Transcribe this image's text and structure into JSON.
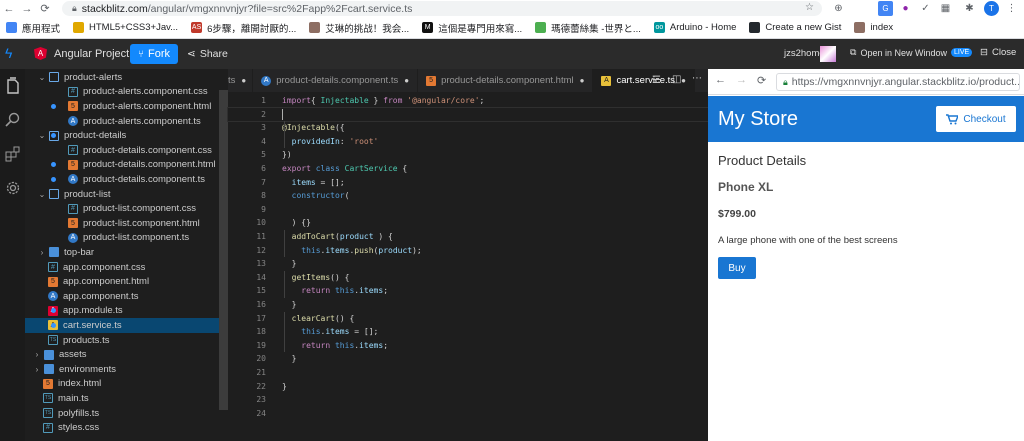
{
  "browser": {
    "url_domain": "stackblitz.com",
    "url_path": "/angular/vmgxnnvnjyr?file=src%2Fapp%2Fcart.service.ts",
    "bookmarks": [
      {
        "label": "應用程式",
        "color": "#4285f4",
        "glyph": ""
      },
      {
        "label": "HTML5+CSS3+Jav...",
        "color": "#e0a800",
        "glyph": ""
      },
      {
        "label": "6步驟，離開討厭的...",
        "color": "#c0392b",
        "glyph": "AS"
      },
      {
        "label": "艾琳的挑战！我会...",
        "color": "#8d6e63",
        "glyph": ""
      },
      {
        "label": "這個是專門用來寫...",
        "color": "#111111",
        "glyph": "M"
      },
      {
        "label": "瑪德蕾絲集 -世界と...",
        "color": "#4caf50",
        "glyph": ""
      },
      {
        "label": "Arduino - Home",
        "color": "#00979d",
        "glyph": "oo"
      },
      {
        "label": "Create a new Gist",
        "color": "#24292e",
        "glyph": ""
      },
      {
        "label": "index",
        "color": "#8d6e63",
        "glyph": ""
      }
    ]
  },
  "header": {
    "project": "Angular Project",
    "fork_label": "Fork",
    "share_label": "Share",
    "user": "jzs2home",
    "open_window": "Open in New Window",
    "live_badge": "LIVE",
    "close_label": "Close"
  },
  "explorer": {
    "items": [
      {
        "label": "product-alerts",
        "type": "folder",
        "level": 0,
        "open": true,
        "dot": false
      },
      {
        "label": "product-alerts.component.css",
        "type": "css",
        "level": 1,
        "dot": false
      },
      {
        "label": "product-alerts.component.html",
        "type": "html",
        "level": 1,
        "dot": true
      },
      {
        "label": "product-alerts.component.ts",
        "type": "ts",
        "level": 1,
        "dot": false
      },
      {
        "label": "product-details",
        "type": "folder",
        "level": 0,
        "open": true,
        "dot": true
      },
      {
        "label": "product-details.component.css",
        "type": "css",
        "level": 1,
        "dot": false
      },
      {
        "label": "product-details.component.html",
        "type": "html",
        "level": 1,
        "dot": true
      },
      {
        "label": "product-details.component.ts",
        "type": "ts",
        "level": 1,
        "dot": true
      },
      {
        "label": "product-list",
        "type": "folder",
        "level": 0,
        "open": true,
        "dot": false
      },
      {
        "label": "product-list.component.css",
        "type": "css",
        "level": 1,
        "dot": false
      },
      {
        "label": "product-list.component.html",
        "type": "html",
        "level": 1,
        "dot": false
      },
      {
        "label": "product-list.component.ts",
        "type": "ts",
        "level": 1,
        "dot": false
      },
      {
        "label": "top-bar",
        "type": "folder",
        "level": 0,
        "open": false,
        "dot": false
      },
      {
        "label": "app.component.css",
        "type": "css",
        "level": 0,
        "dot": false
      },
      {
        "label": "app.component.html",
        "type": "html",
        "level": 0,
        "dot": false
      },
      {
        "label": "app.component.ts",
        "type": "ts",
        "level": 0,
        "dot": false
      },
      {
        "label": "app.module.ts",
        "type": "ang",
        "level": 0,
        "dot": true
      },
      {
        "label": "cart.service.ts",
        "type": "svc",
        "level": 0,
        "dot": true,
        "selected": true
      },
      {
        "label": "products.ts",
        "type": "tsfile",
        "level": 0,
        "dot": false
      },
      {
        "label": "assets",
        "type": "folder",
        "level": -1,
        "open": false,
        "dot": false
      },
      {
        "label": "environments",
        "type": "folder",
        "level": -1,
        "open": false,
        "dot": false
      },
      {
        "label": "index.html",
        "type": "html",
        "level": -1,
        "dot": false
      },
      {
        "label": "main.ts",
        "type": "tsfile",
        "level": -1,
        "dot": false
      },
      {
        "label": "polyfills.ts",
        "type": "tsfile",
        "level": -1,
        "dot": false
      },
      {
        "label": "styles.css",
        "type": "css",
        "level": -1,
        "dot": false
      }
    ]
  },
  "tabs": [
    {
      "label": "ts",
      "icon": "",
      "active": false
    },
    {
      "label": "product-details.component.ts",
      "icon": "ts",
      "active": false
    },
    {
      "label": "product-details.component.html",
      "icon": "html",
      "active": false
    },
    {
      "label": "cart.service.ts",
      "icon": "svc",
      "active": true
    }
  ],
  "editor": {
    "current_line": 2,
    "lines": [
      [
        [
          "kw",
          "import"
        ],
        [
          "",
          "{ "
        ],
        [
          "cls",
          "Injectable"
        ],
        [
          "",
          " } "
        ],
        [
          "kw",
          "from"
        ],
        [
          "",
          " "
        ],
        [
          "str",
          "'@angular/core'"
        ],
        [
          "",
          ";"
        ]
      ],
      [],
      [
        [
          "dec",
          "@Injectable"
        ],
        [
          "",
          "({"
        ]
      ],
      [
        [
          "",
          "  "
        ],
        [
          "prop",
          "providedIn"
        ],
        [
          "",
          ": "
        ],
        [
          "str",
          "'root'"
        ]
      ],
      [
        [
          "",
          "})"
        ]
      ],
      [
        [
          "kw",
          "export"
        ],
        [
          "kwb",
          " class "
        ],
        [
          "cls",
          "CartService"
        ],
        [
          "",
          " {"
        ]
      ],
      [
        [
          "",
          "  "
        ],
        [
          "prop",
          "items"
        ],
        [
          "",
          " = [];"
        ]
      ],
      [
        [
          "",
          "  "
        ],
        [
          "kwb",
          "constructor"
        ],
        [
          "",
          "("
        ]
      ],
      [],
      [
        [
          "",
          "  ) {}"
        ]
      ],
      [
        [
          "",
          "  "
        ],
        [
          "fn",
          "addToCart"
        ],
        [
          "",
          "("
        ],
        [
          "prop",
          "product"
        ],
        [
          "",
          " ) {"
        ]
      ],
      [
        [
          "",
          "    "
        ],
        [
          "kwb",
          "this"
        ],
        [
          "",
          "."
        ],
        [
          "prop",
          "items"
        ],
        [
          "",
          "."
        ],
        [
          "fn",
          "push"
        ],
        [
          "",
          "("
        ],
        [
          "prop",
          "product"
        ],
        [
          "",
          ");"
        ]
      ],
      [
        [
          "",
          "  }"
        ]
      ],
      [
        [
          "",
          "  "
        ],
        [
          "fn",
          "getItems"
        ],
        [
          "",
          "() {"
        ]
      ],
      [
        [
          "",
          "    "
        ],
        [
          "kw",
          "return"
        ],
        [
          "kwb",
          " this"
        ],
        [
          "",
          "."
        ],
        [
          "prop",
          "items"
        ],
        [
          "",
          ";"
        ]
      ],
      [
        [
          "",
          "  }"
        ]
      ],
      [
        [
          "",
          "  "
        ],
        [
          "fn",
          "clearCart"
        ],
        [
          "",
          "() {"
        ]
      ],
      [
        [
          "",
          "    "
        ],
        [
          "kwb",
          "this"
        ],
        [
          "",
          "."
        ],
        [
          "prop",
          "items"
        ],
        [
          "",
          " = [];"
        ]
      ],
      [
        [
          "",
          "    "
        ],
        [
          "kw",
          "return"
        ],
        [
          "kwb",
          " this"
        ],
        [
          "",
          "."
        ],
        [
          "prop",
          "items"
        ],
        [
          "",
          ";"
        ]
      ],
      [
        [
          "",
          "  }"
        ]
      ],
      [],
      [
        [
          "",
          "}"
        ]
      ],
      [],
      []
    ]
  },
  "preview": {
    "url": "https://vmgxnnvnjyr.angular.stackblitz.io/product...",
    "store_title": "My Store",
    "checkout_label": "Checkout",
    "section_title": "Product Details",
    "product_name": "Phone XL",
    "price": "$799.00",
    "description": "A large phone with one of the best screens",
    "buy_label": "Buy"
  },
  "colors": {
    "accent": "#1389fd",
    "store_blue": "#1976d2",
    "selected_row": "#094771"
  }
}
